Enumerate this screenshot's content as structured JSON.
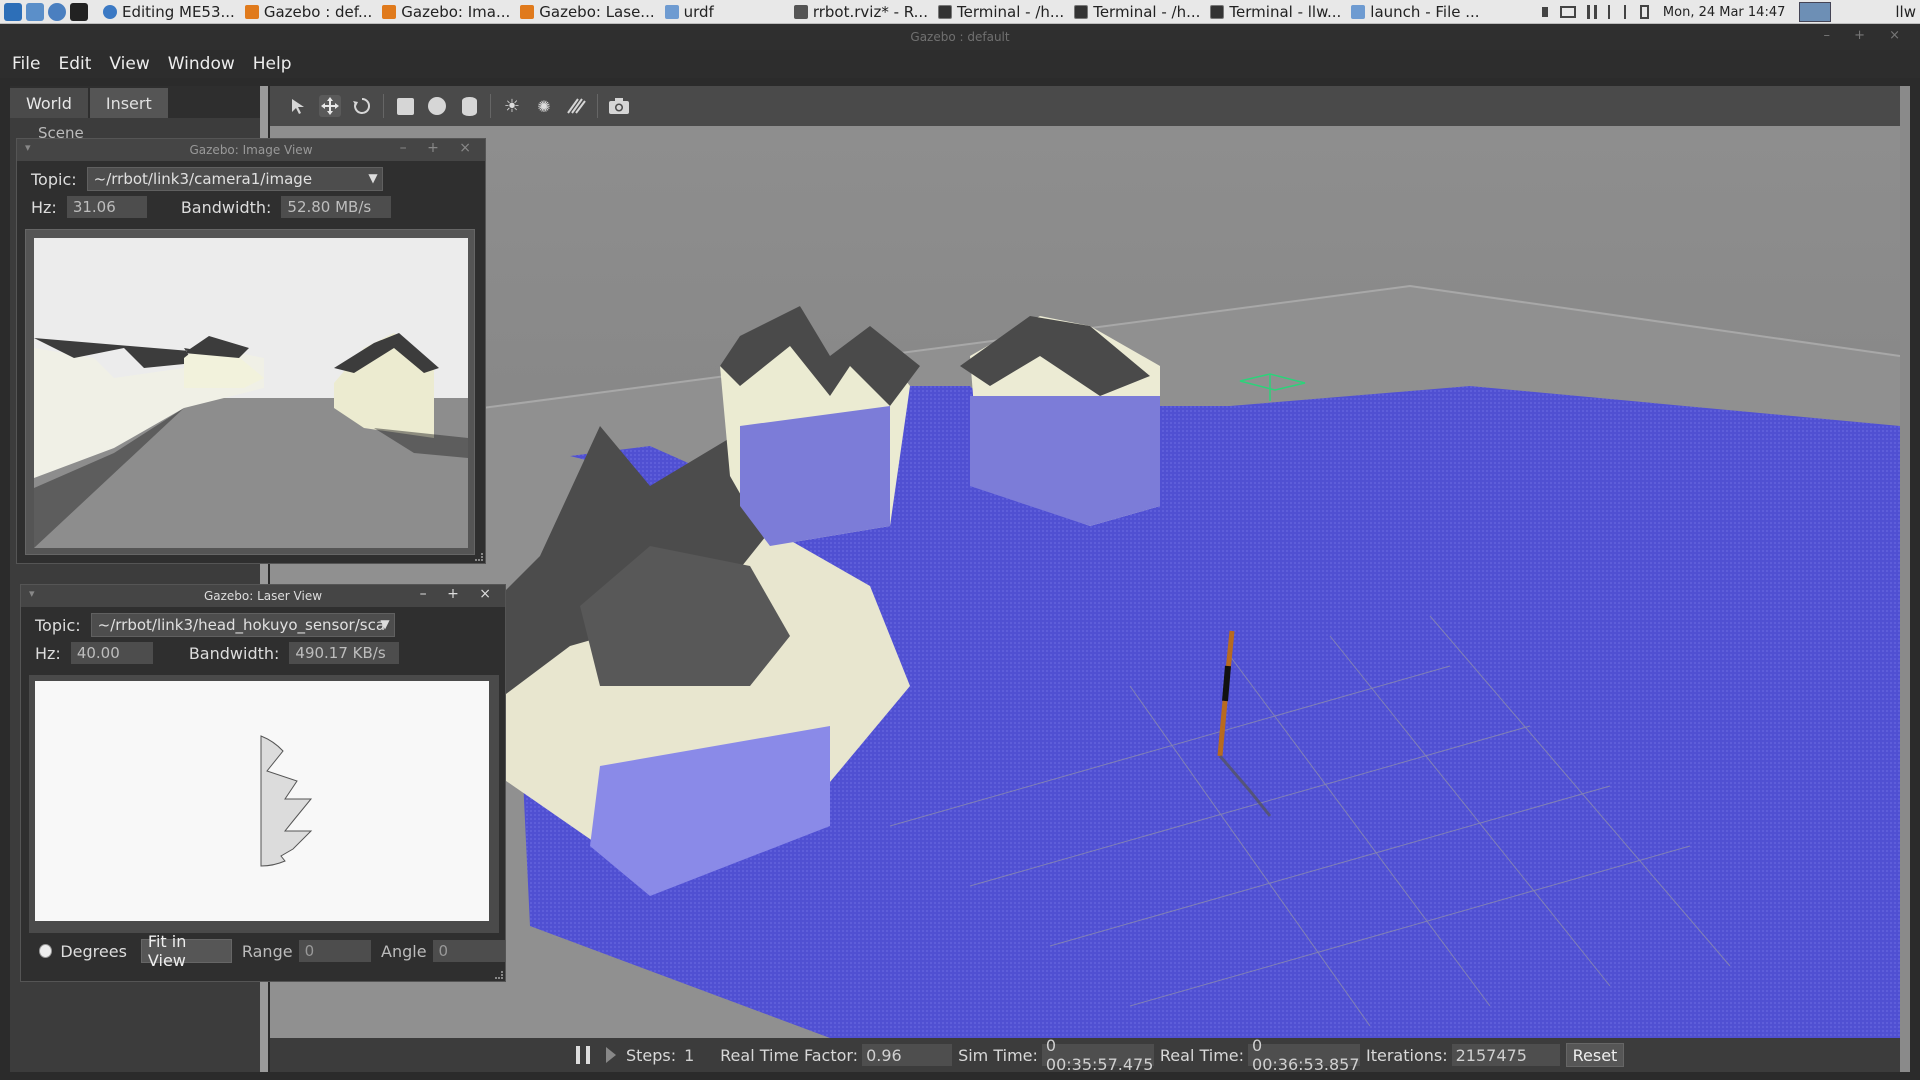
{
  "taskbar": {
    "tasks": [
      {
        "label": "Editing ME53..."
      },
      {
        "label": "Gazebo : def..."
      },
      {
        "label": "Gazebo: Ima..."
      },
      {
        "label": "Gazebo: Lase..."
      },
      {
        "label": "urdf"
      },
      {
        "label": "rrbot.rviz* - R..."
      },
      {
        "label": "Terminal - /h..."
      },
      {
        "label": "Terminal - /h..."
      },
      {
        "label": "Terminal - llw..."
      },
      {
        "label": "launch - File ..."
      }
    ],
    "clock": "Mon, 24 Mar  14:47",
    "user": "llw"
  },
  "window": {
    "title": "Gazebo : default"
  },
  "menu": {
    "file": "File",
    "edit": "Edit",
    "view": "View",
    "window": "Window",
    "help": "Help"
  },
  "left_panel": {
    "tab_world": "World",
    "tab_insert": "Insert",
    "scene_label": "Scene"
  },
  "image_view": {
    "title": "Gazebo: Image View",
    "topic_label": "Topic:",
    "topic_value": "~/rrbot/link3/camera1/image",
    "hz_label": "Hz:",
    "hz_value": "31.06",
    "bandwidth_label": "Bandwidth:",
    "bandwidth_value": "52.80 MB/s"
  },
  "laser_view": {
    "title": "Gazebo: Laser View",
    "topic_label": "Topic:",
    "topic_value": "~/rrbot/link3/head_hokuyo_sensor/sca",
    "hz_label": "Hz:",
    "hz_value": "40.00",
    "bandwidth_label": "Bandwidth:",
    "bandwidth_value": "490.17 KB/s",
    "degrees_label": "Degrees",
    "fit_label": "Fit in View",
    "range_label": "Range",
    "range_value": "0",
    "angle_label": "Angle",
    "angle_value": "0"
  },
  "status": {
    "steps_label": "Steps:",
    "steps_value": "1",
    "rtf_label": "Real Time Factor:",
    "rtf_value": "0.96",
    "sim_label": "Sim Time:",
    "sim_value": "0 00:35:57.475",
    "real_label": "Real Time:",
    "real_value": "0 00:36:53.857",
    "iter_label": "Iterations:",
    "iter_value": "2157475",
    "reset_label": "Reset"
  },
  "colors": {
    "laser": "#4a4ad8",
    "ground": "#8c8c8c",
    "panel": "#3c3c3c"
  }
}
